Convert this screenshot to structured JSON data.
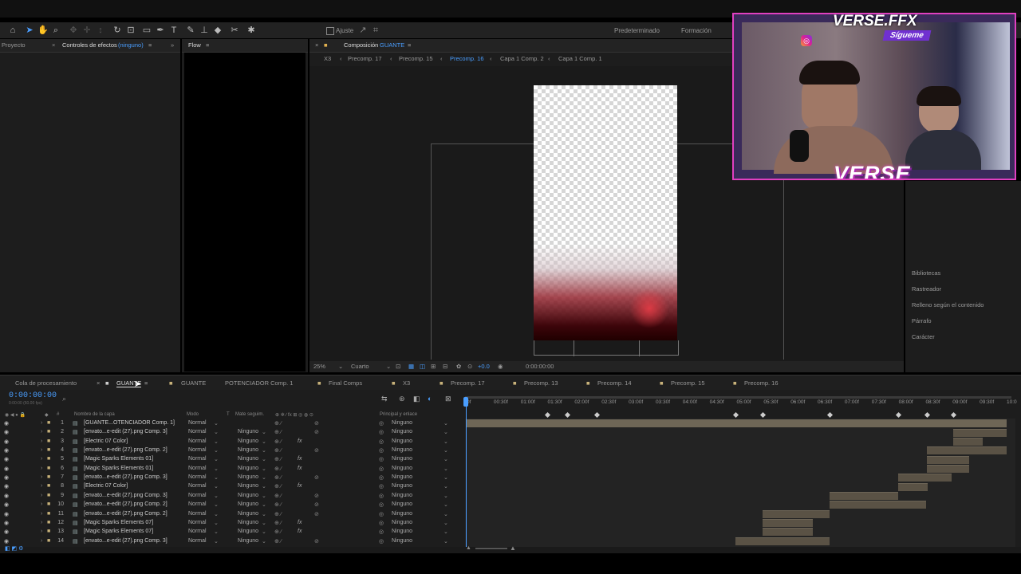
{
  "toolbar": {
    "ajuste": "Ajuste",
    "workspaces": [
      "Predeterminado",
      "Formación"
    ]
  },
  "left_panel": {
    "tab_project": "Proyecto",
    "tab_effects": "Controles de efectos",
    "effects_target": "(ninguno)"
  },
  "flow_panel": {
    "title": "Flow"
  },
  "comp_panel": {
    "label": "Composición",
    "name": "GUANTE",
    "breadcrumbs": [
      "X3",
      "Precomp. 17",
      "Precomp. 15",
      "Precomp. 16",
      "Capa 1 Comp. 2",
      "Capa 1 Comp. 1"
    ],
    "active_breadcrumb": "Precomp. 16",
    "zoom": "25%",
    "resolution": "Cuarto",
    "exposure": "+0.0",
    "timecode": "0:00:00:00"
  },
  "right_panel": [
    "Bibliotecas",
    "Rastreador",
    "Relleno según el contenido",
    "Párrafo",
    "Carácter"
  ],
  "webcam": {
    "brand_top": "VERSE.FFX",
    "follow": "Sígueme",
    "brand_bottom": "VERSE"
  },
  "timeline": {
    "tabs": [
      "Cola de procesamiento",
      "GUANTE",
      "GUANTE",
      "POTENCIADOR Comp. 1",
      "Final Comps",
      "X3",
      "Precomp. 17",
      "Precomp. 13",
      "Precomp. 14",
      "Precomp. 15",
      "Precomp. 16"
    ],
    "timecode": "0:00:00:00",
    "fps": "0:00:00 (60.00 fps)",
    "column_headers": [
      "#",
      "Nombre de la capa",
      "Modo",
      "T",
      "Mate seguim.",
      "Principal y enlace"
    ],
    "ruler": [
      "0f",
      "00:30f",
      "01:00f",
      "01:30f",
      "02:00f",
      "02:30f",
      "03:00f",
      "03:30f",
      "04:00f",
      "04:30f",
      "05:00f",
      "05:30f",
      "06:00f",
      "06:30f",
      "07:00f",
      "07:30f",
      "08:00f",
      "08:30f",
      "09:00f",
      "09:30f",
      "10:0"
    ],
    "layers": [
      {
        "num": "1",
        "name": "[GUANTE...OTENCIADOR Comp. 1]",
        "mode": "Normal",
        "matte": "",
        "parent": "Ninguno",
        "fx": false
      },
      {
        "num": "2",
        "name": "[envato...e-edit (27).png Comp. 3]",
        "mode": "Normal",
        "matte": "Ninguno",
        "parent": "Ninguno",
        "fx": false
      },
      {
        "num": "3",
        "name": "[Electric 07 Color]",
        "mode": "Normal",
        "matte": "Ninguno",
        "parent": "Ninguno",
        "fx": true
      },
      {
        "num": "4",
        "name": "[envato...e-edit (27).png Comp. 2]",
        "mode": "Normal",
        "matte": "Ninguno",
        "parent": "Ninguno",
        "fx": false
      },
      {
        "num": "5",
        "name": "[Magic Sparks Elements 01]",
        "mode": "Normal",
        "matte": "Ninguno",
        "parent": "Ninguno",
        "fx": true
      },
      {
        "num": "6",
        "name": "[Magic Sparks Elements 01]",
        "mode": "Normal",
        "matte": "Ninguno",
        "parent": "Ninguno",
        "fx": true
      },
      {
        "num": "7",
        "name": "[envato...e-edit (27).png Comp. 3]",
        "mode": "Normal",
        "matte": "Ninguno",
        "parent": "Ninguno",
        "fx": false
      },
      {
        "num": "8",
        "name": "[Electric 07 Color]",
        "mode": "Normal",
        "matte": "Ninguno",
        "parent": "Ninguno",
        "fx": true
      },
      {
        "num": "9",
        "name": "[envato...e-edit (27).png Comp. 3]",
        "mode": "Normal",
        "matte": "Ninguno",
        "parent": "Ninguno",
        "fx": false
      },
      {
        "num": "10",
        "name": "[envato...e-edit (27).png Comp. 2]",
        "mode": "Normal",
        "matte": "Ninguno",
        "parent": "Ninguno",
        "fx": false
      },
      {
        "num": "11",
        "name": "[envato...e-edit (27).png Comp. 2]",
        "mode": "Normal",
        "matte": "Ninguno",
        "parent": "Ninguno",
        "fx": false
      },
      {
        "num": "12",
        "name": "[Magic Sparks Elements 07]",
        "mode": "Normal",
        "matte": "Ninguno",
        "parent": "Ninguno",
        "fx": true
      },
      {
        "num": "13",
        "name": "[Magic Sparks Elements 07]",
        "mode": "Normal",
        "matte": "Ninguno",
        "parent": "Ninguno",
        "fx": true
      },
      {
        "num": "14",
        "name": "[envato...e-edit (27).png Comp. 3]",
        "mode": "Normal",
        "matte": "Ninguno",
        "parent": "Ninguno",
        "fx": false
      }
    ]
  },
  "colors": {
    "accent": "#4a9eff",
    "panel": "#1d1d1d",
    "bar": "#5a5245",
    "stream_pink": "#e040c0"
  }
}
